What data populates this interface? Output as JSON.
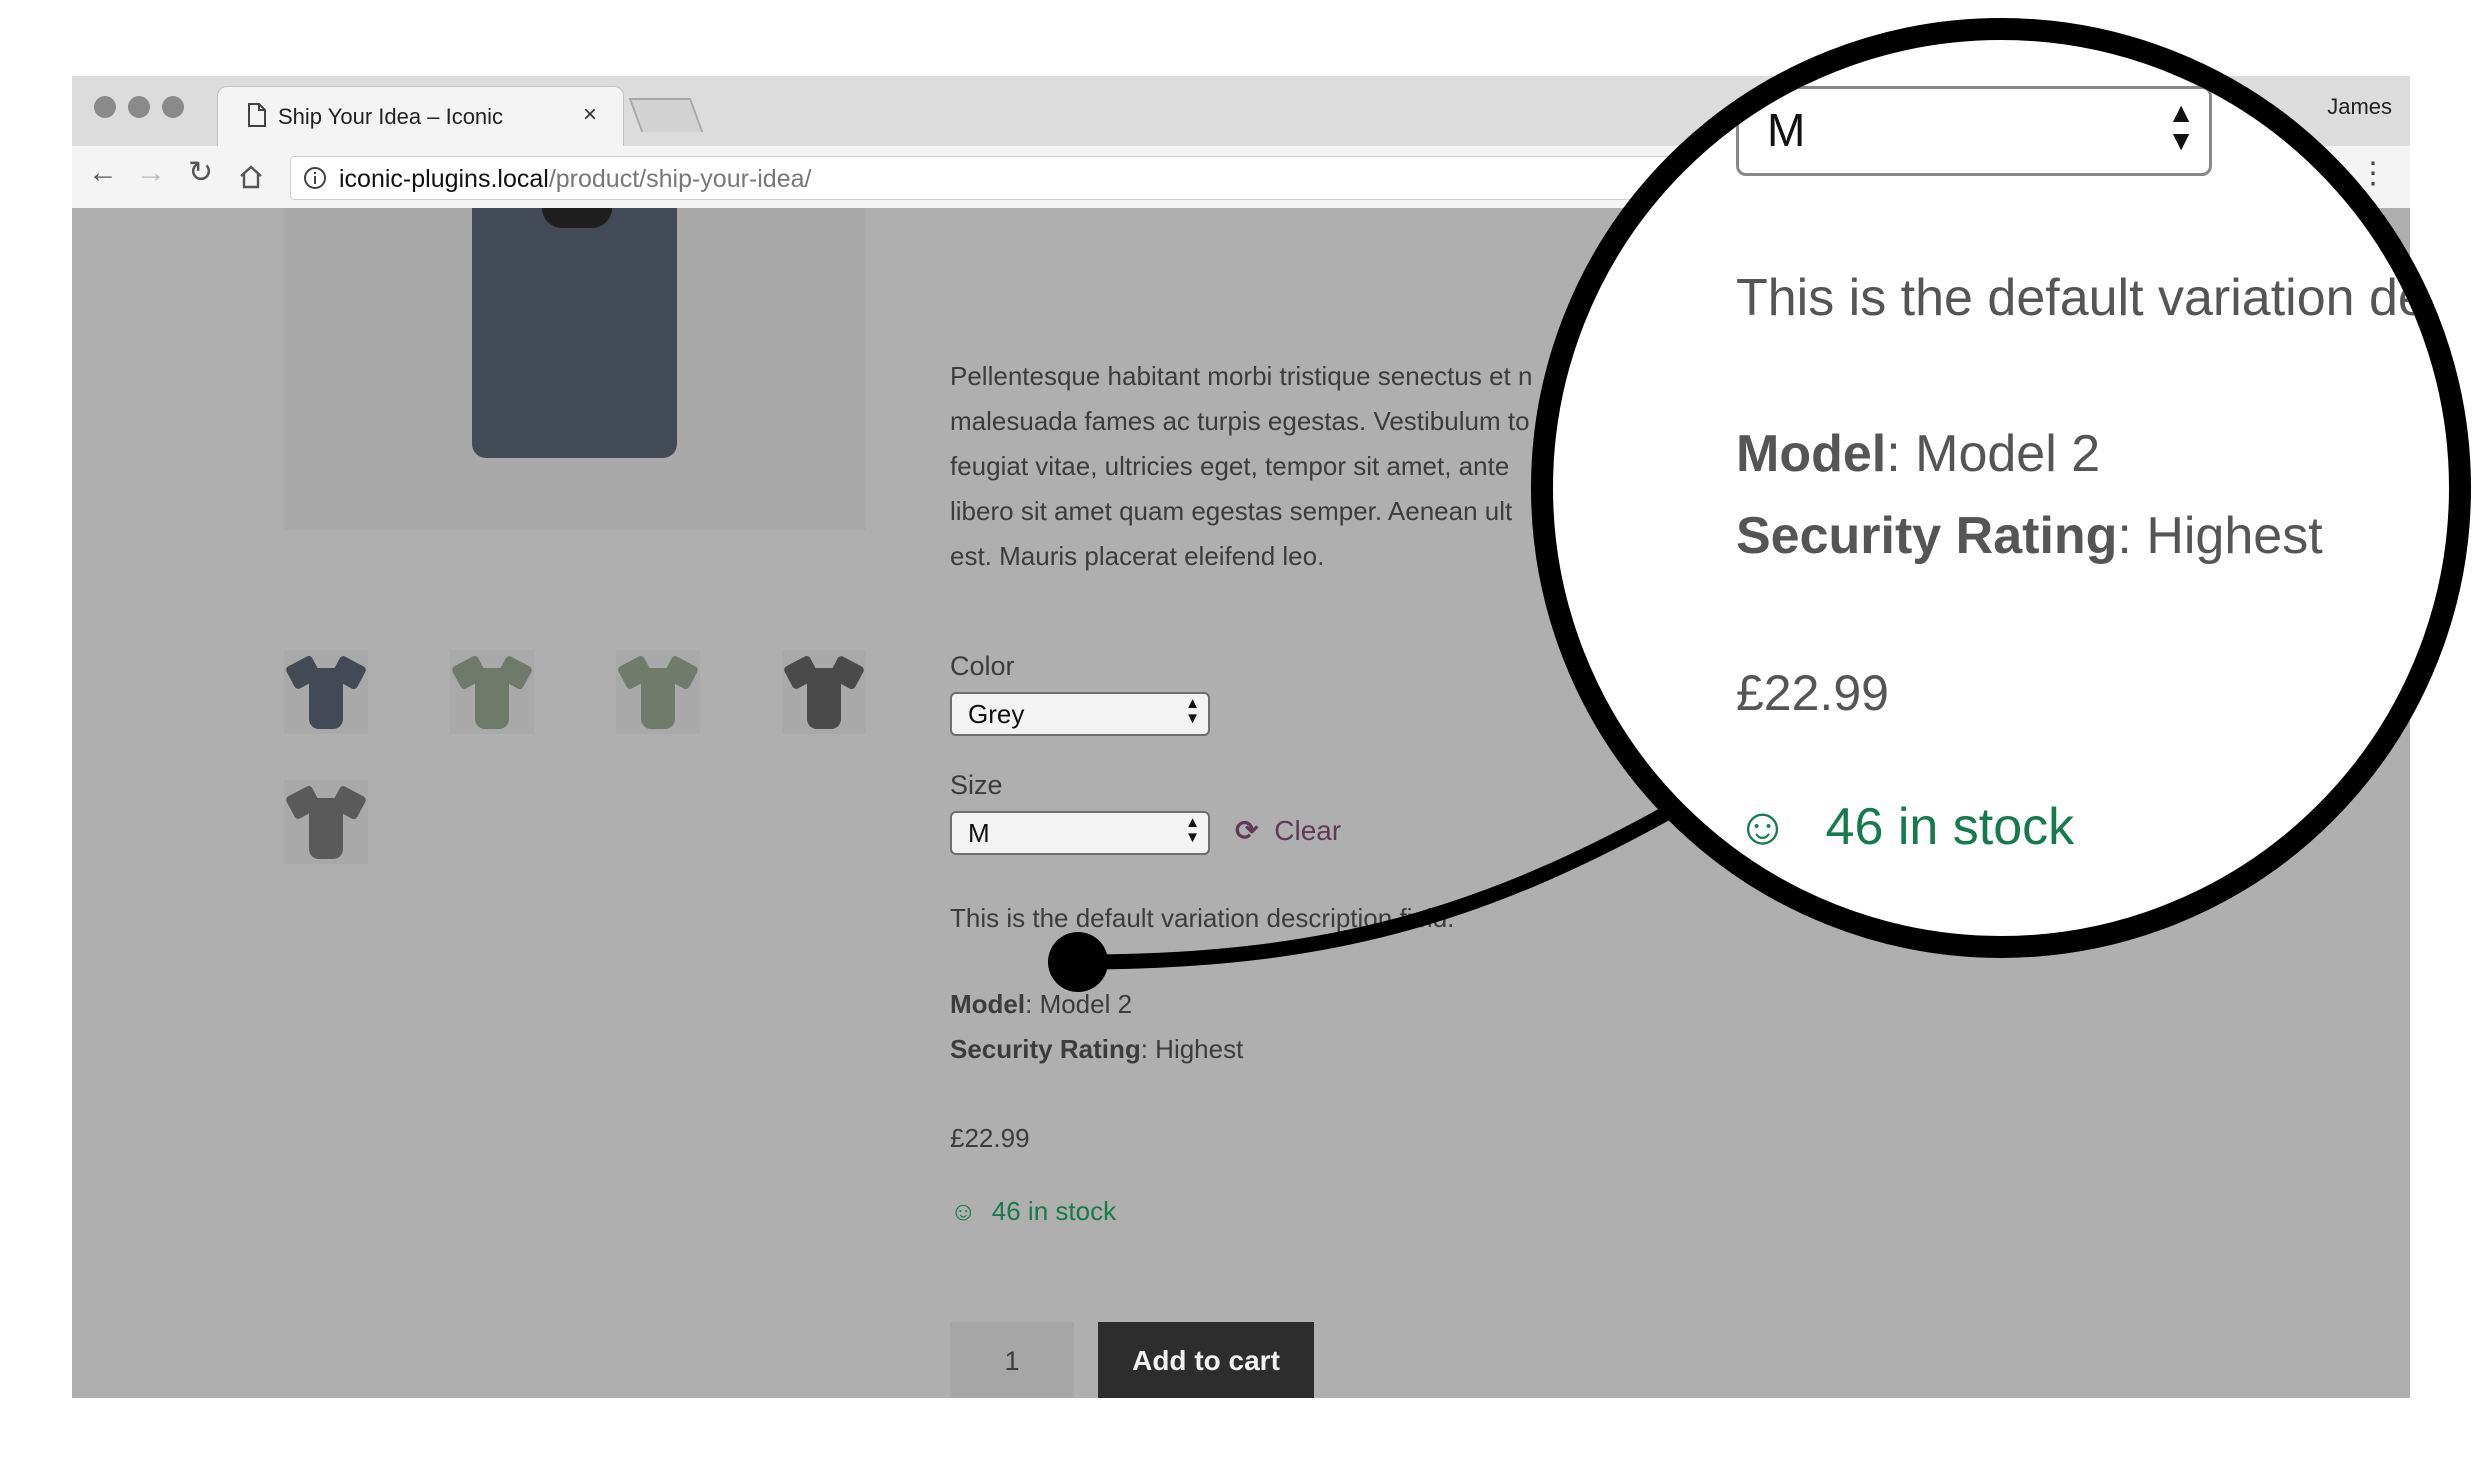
{
  "browser": {
    "tab_title": "Ship Your Idea – Iconic",
    "tab_close": "×",
    "user_name": "James",
    "url_host": "iconic-plugins.local",
    "url_path": "/product/ship-your-idea/",
    "icons": [
      "back-icon",
      "forward-icon",
      "reload-icon",
      "home-icon",
      "info-icon",
      "menu-icon",
      "page-icon"
    ]
  },
  "product": {
    "description": [
      "Pellentesque habitant morbi tristique senectus et n",
      "malesuada fames ac turpis egestas. Vestibulum to",
      "feugiat vitae, ultricies eget, tempor sit amet, ante",
      "libero sit amet quam egestas semper. Aenean ult",
      "est. Mauris placerat eleifend leo."
    ],
    "color_label": "Color",
    "color_value": "Grey",
    "size_label": "Size",
    "size_value": "M",
    "clear_label": "Clear",
    "variation_description": "This is the default variation description field.",
    "model_label": "Model",
    "model_value": "Model 2",
    "security_label": "Security Rating",
    "security_value": "Highest",
    "price": "£22.99",
    "stock": "46 in stock",
    "quantity": "1",
    "add_to_cart": "Add to cart",
    "thumbnail_colors": [
      "#434a55",
      "#6f7a6a",
      "#707b6c",
      "#4a4a4a",
      "#5a5a5a"
    ],
    "main_image_color": "#424a56"
  },
  "magnified": {
    "size_value": "M",
    "variation_description": "This is the default variation des",
    "model_label": "Model",
    "model_value": "Model 2",
    "security_label": "Security Rating",
    "security_value": "Highest",
    "price": "£22.99",
    "stock": "46 in stock"
  },
  "colors": {
    "stock_green": "#157a4c",
    "clear_link": "#5e3b55",
    "button_dark": "#2d2d2d",
    "overlay_grey": "#afafaf"
  }
}
